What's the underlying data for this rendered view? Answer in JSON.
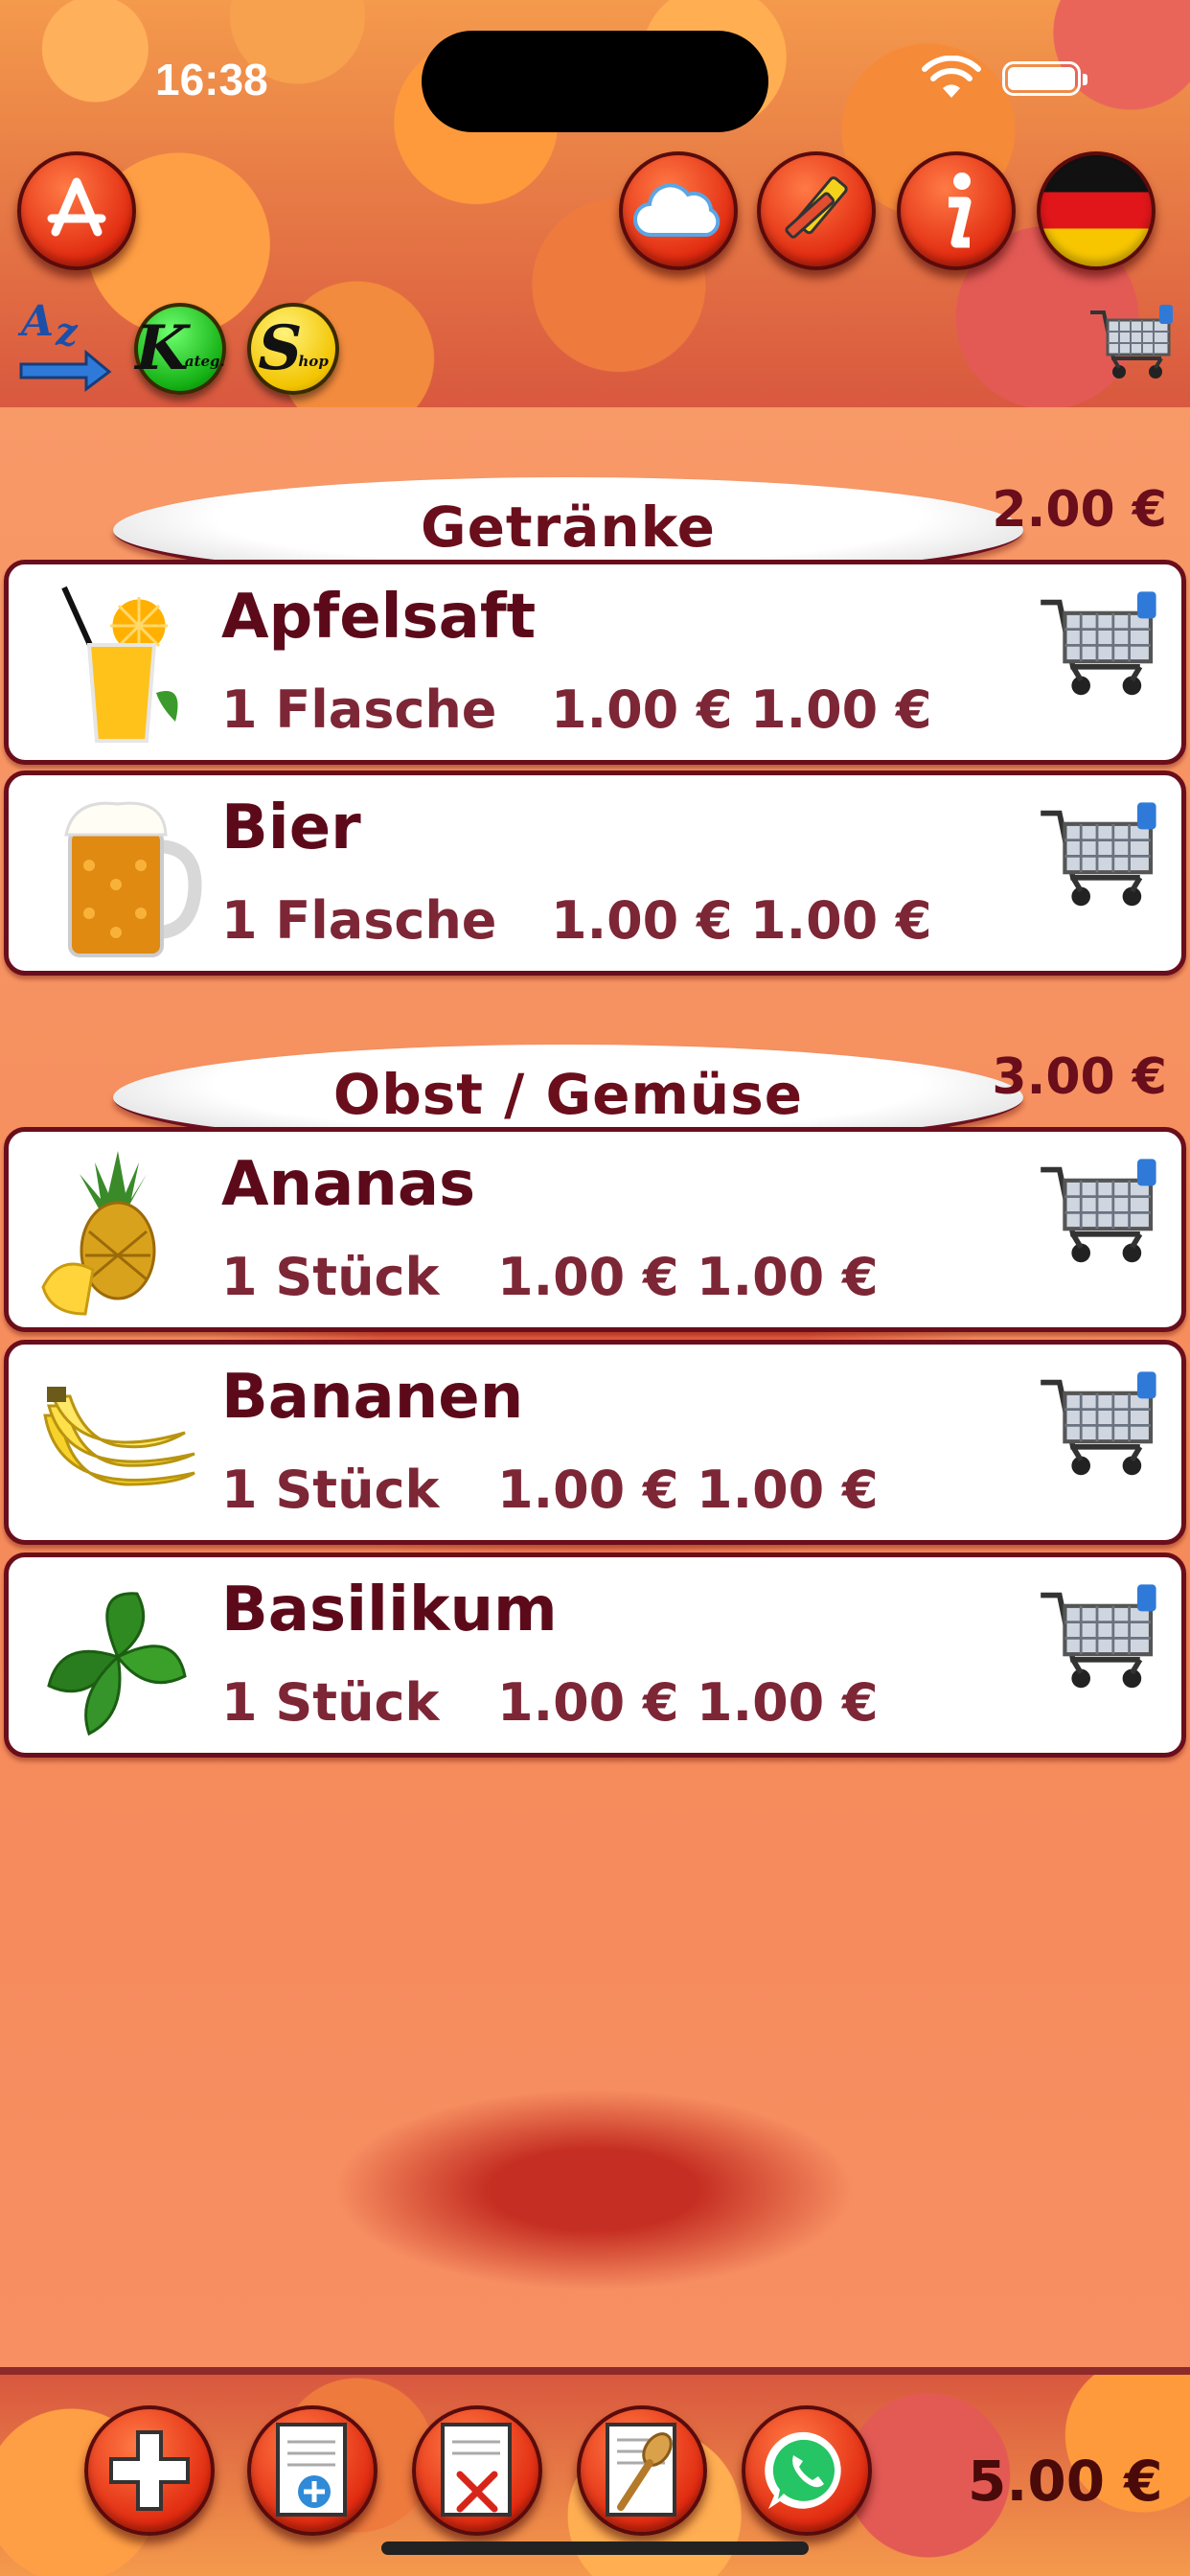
{
  "status_bar": {
    "time": "16:38"
  },
  "toolbar": {
    "k_button": {
      "letter": "K",
      "sub": "ateg."
    },
    "s_button": {
      "letter": "S",
      "sub": "hop"
    },
    "sort_label": "Az"
  },
  "sections": [
    {
      "title": "Getränke",
      "total": "2.00 €",
      "items": [
        {
          "name": "Apfelsaft",
          "quantity": "1 Flasche",
          "unit_price": "1.00 €",
          "total": "1.00 €"
        },
        {
          "name": "Bier",
          "quantity": "1 Flasche",
          "unit_price": "1.00 €",
          "total": "1.00 €"
        }
      ]
    },
    {
      "title": "Obst / Gemüse",
      "total": "3.00 €",
      "items": [
        {
          "name": "Ananas",
          "quantity": "1 Stück",
          "unit_price": "1.00 €",
          "total": "1.00 €"
        },
        {
          "name": "Bananen",
          "quantity": "1 Stück",
          "unit_price": "1.00 €",
          "total": "1.00 €"
        },
        {
          "name": "Basilikum",
          "quantity": "1 Stück",
          "unit_price": "1.00 €",
          "total": "1.00 €"
        }
      ]
    }
  ],
  "bottom_bar": {
    "grand_total": "5.00 €"
  },
  "icons": {
    "top_left": "app-store-icon",
    "cloud": "cloud-icon",
    "edit": "marker-pen-icon",
    "info": "info-icon",
    "language": "german-flag-icon",
    "sort": "sort-az-icon",
    "cart": "shopping-cart-icon",
    "add": "plus-icon",
    "add_list": "add-list-icon",
    "delete_list": "delete-list-icon",
    "recipe": "recipe-spoon-icon",
    "whatsapp": "whatsapp-icon"
  },
  "colors": {
    "accent": "#6a0e1c",
    "button_red": "#e12a10",
    "background": "#f79466"
  }
}
